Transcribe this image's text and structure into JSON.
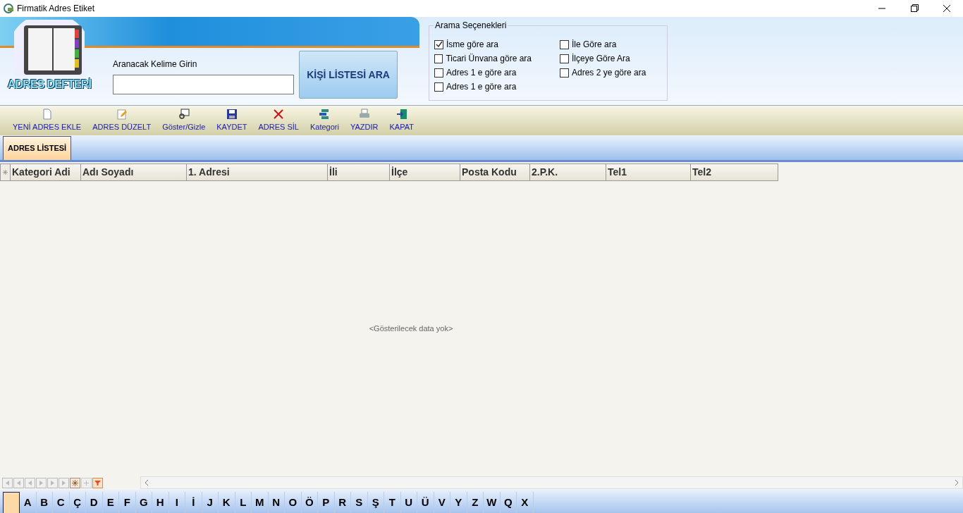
{
  "window": {
    "title": "Firmatik Adres Etiket"
  },
  "header": {
    "logo_text": "ADRES DEFTERİ",
    "search_label": "Aranacak Kelime Girin",
    "search_button": "KİŞİ LİSTESİ ARA"
  },
  "search_options": {
    "title": "Arama Seçenekleri",
    "columns": [
      [
        {
          "label": "İsme göre ara",
          "checked": true
        },
        {
          "label": "Ticari Ünvana göre ara",
          "checked": false
        },
        {
          "label": "Adres 1 e göre ara",
          "checked": false
        },
        {
          "label": "Adres 1 e göre ara",
          "checked": false
        }
      ],
      [
        {
          "label": "İle Göre ara",
          "checked": false
        },
        {
          "label": "İlçeye Göre Ara",
          "checked": false
        },
        {
          "label": "Adres 2 ye göre ara",
          "checked": false
        }
      ]
    ]
  },
  "toolbar": [
    {
      "label": "YENİ ADRES EKLE",
      "kind": "new"
    },
    {
      "label": "ADRES DÜZELT",
      "kind": "edit"
    },
    {
      "label": "Göster/Gizle",
      "kind": "show"
    },
    {
      "label": "KAYDET",
      "kind": "save"
    },
    {
      "label": "ADRES SİL",
      "kind": "delete"
    },
    {
      "label": "Kategori",
      "kind": "category"
    },
    {
      "label": "YAZDIR",
      "kind": "print"
    },
    {
      "label": "KAPAT",
      "kind": "close"
    }
  ],
  "tabs": [
    {
      "label": "ADRES LİSTESİ",
      "selected": true
    }
  ],
  "table": {
    "columns": [
      "Kategori Adi",
      "Adı Soyadı",
      "1. Adresi",
      "İli",
      "İlçe",
      "Posta Kodu",
      "2.P.K.",
      "Tel1",
      "Tel2"
    ],
    "empty_text": "<Gösterilecek data yok>"
  },
  "letter_bar": {
    "blank_tab_selected": true,
    "letters": [
      {
        "label": "A",
        "selected": false
      },
      {
        "label": "B",
        "selected": false
      },
      {
        "label": "C",
        "selected": false
      },
      {
        "label": "Ç",
        "selected": false
      },
      {
        "label": "D",
        "selected": false
      },
      {
        "label": "E",
        "selected": false
      },
      {
        "label": "F",
        "selected": false
      },
      {
        "label": "G",
        "selected": false
      },
      {
        "label": "H",
        "selected": false
      },
      {
        "label": "I",
        "selected": false
      },
      {
        "label": "İ",
        "selected": false
      },
      {
        "label": "J",
        "selected": false
      },
      {
        "label": "K",
        "selected": false
      },
      {
        "label": "L",
        "selected": false
      },
      {
        "label": "M",
        "selected": false
      },
      {
        "label": "N",
        "selected": false
      },
      {
        "label": "O",
        "selected": false
      },
      {
        "label": "Ö",
        "selected": false
      },
      {
        "label": "P",
        "selected": false
      },
      {
        "label": "R",
        "selected": false
      },
      {
        "label": "S",
        "selected": false
      },
      {
        "label": "Ş",
        "selected": false
      },
      {
        "label": "T",
        "selected": false
      },
      {
        "label": "U",
        "selected": false
      },
      {
        "label": "Ü",
        "selected": false
      },
      {
        "label": "V",
        "selected": false
      },
      {
        "label": "Y",
        "selected": false
      },
      {
        "label": "Z",
        "selected": false
      },
      {
        "label": "W",
        "selected": false
      },
      {
        "label": "Q",
        "selected": false
      },
      {
        "label": "X",
        "selected": false
      }
    ]
  }
}
